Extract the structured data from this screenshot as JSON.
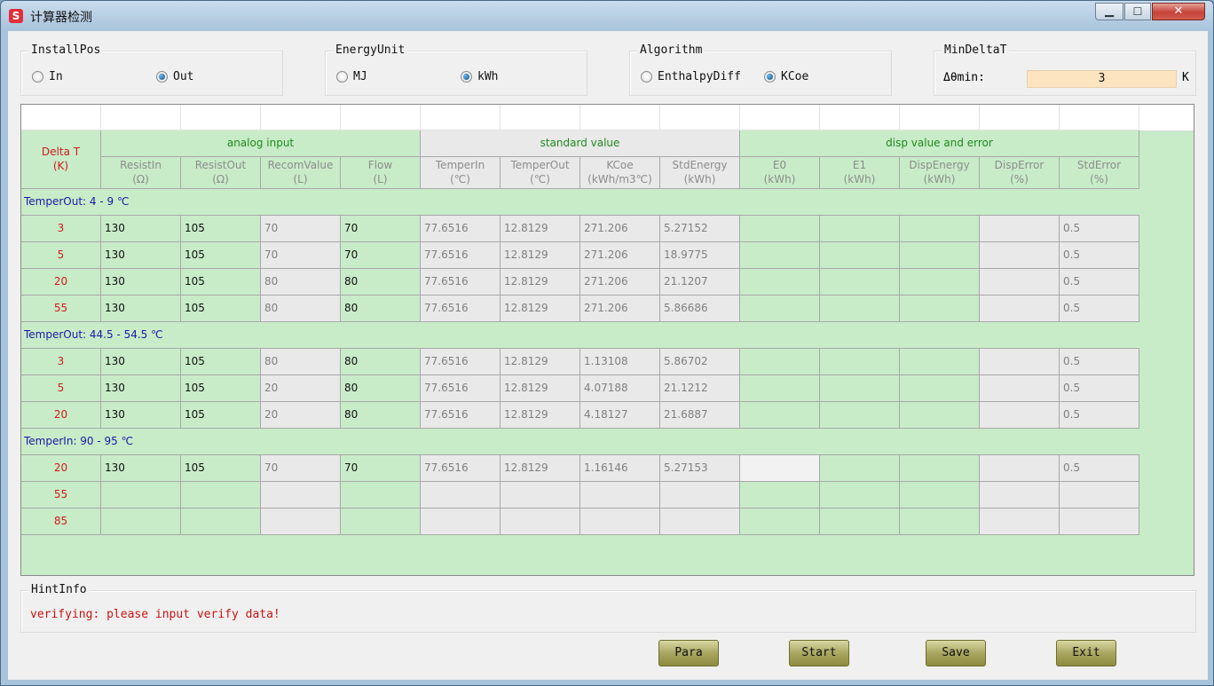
{
  "window": {
    "title": "计算器检测",
    "app_icon": "S",
    "minimize_glyph": "▁",
    "maximize_glyph": "☐",
    "close_glyph": "✕"
  },
  "install_pos": {
    "label": "InstallPos",
    "options": [
      "In",
      "Out"
    ],
    "selected": "Out"
  },
  "energy_unit": {
    "label": "EnergyUnit",
    "options": [
      "MJ",
      "kWh"
    ],
    "selected": "kWh"
  },
  "algorithm": {
    "label": "Algorithm",
    "options": [
      "EnthalpyDiff",
      "KCoe"
    ],
    "selected": "KCoe"
  },
  "min_delta": {
    "label": "MinDeltaT",
    "field_label": "Δθmin:",
    "value": "3",
    "unit": "K"
  },
  "grid": {
    "delta_header": [
      "Delta T",
      "(K)"
    ],
    "groups": [
      "analog input",
      "standard value",
      "disp value and error"
    ],
    "columns": [
      {
        "name": "ResistIn",
        "unit": "(Ω)"
      },
      {
        "name": "ResistOut",
        "unit": "(Ω)"
      },
      {
        "name": "RecomValue",
        "unit": "(L)"
      },
      {
        "name": "Flow",
        "unit": "(L)"
      },
      {
        "name": "TemperIn",
        "unit": "(℃)"
      },
      {
        "name": "TemperOut",
        "unit": "(℃)"
      },
      {
        "name": "KCoe",
        "unit": "(kWh/m3℃)"
      },
      {
        "name": "StdEnergy",
        "unit": "(kWh)"
      },
      {
        "name": "E0",
        "unit": "(kWh)"
      },
      {
        "name": "E1",
        "unit": "(kWh)"
      },
      {
        "name": "DispEnergy",
        "unit": "(kWh)"
      },
      {
        "name": "DispError",
        "unit": "(%)"
      },
      {
        "name": "StdError",
        "unit": "(%)"
      }
    ],
    "sections": [
      {
        "title": "TemperOut: 4 - 9 ℃",
        "rows": [
          {
            "dT": "3",
            "cells": [
              "130",
              "105",
              "70",
              "70",
              "77.6516",
              "12.8129",
              "271.206",
              "5.27152",
              "",
              "",
              "",
              "",
              "0.5"
            ]
          },
          {
            "dT": "5",
            "cells": [
              "130",
              "105",
              "70",
              "70",
              "77.6516",
              "12.8129",
              "271.206",
              "18.9775",
              "",
              "",
              "",
              "",
              "0.5"
            ]
          },
          {
            "dT": "20",
            "cells": [
              "130",
              "105",
              "80",
              "80",
              "77.6516",
              "12.8129",
              "271.206",
              "21.1207",
              "",
              "",
              "",
              "",
              "0.5"
            ]
          },
          {
            "dT": "55",
            "cells": [
              "130",
              "105",
              "80",
              "80",
              "77.6516",
              "12.8129",
              "271.206",
              "5.86686",
              "",
              "",
              "",
              "",
              "0.5"
            ]
          }
        ]
      },
      {
        "title": "TemperOut: 44.5 - 54.5 ℃",
        "rows": [
          {
            "dT": "3",
            "cells": [
              "130",
              "105",
              "80",
              "80",
              "77.6516",
              "12.8129",
              "1.13108",
              "5.86702",
              "",
              "",
              "",
              "",
              "0.5"
            ]
          },
          {
            "dT": "5",
            "cells": [
              "130",
              "105",
              "20",
              "80",
              "77.6516",
              "12.8129",
              "4.07188",
              "21.1212",
              "",
              "",
              "",
              "",
              "0.5"
            ]
          },
          {
            "dT": "20",
            "cells": [
              "130",
              "105",
              "20",
              "80",
              "77.6516",
              "12.8129",
              "4.18127",
              "21.6887",
              "",
              "",
              "",
              "",
              "0.5"
            ]
          }
        ]
      },
      {
        "title": "TemperIn: 90 - 95 ℃",
        "rows": [
          {
            "dT": "20",
            "cells": [
              "130",
              "105",
              "70",
              "70",
              "77.6516",
              "12.8129",
              "1.16146",
              "5.27153",
              "",
              "",
              "",
              "",
              "0.5"
            ]
          },
          {
            "dT": "55",
            "cells": [
              "",
              "",
              "",
              "",
              "",
              "",
              "",
              "",
              "",
              "",
              "",
              "",
              ""
            ]
          },
          {
            "dT": "85",
            "cells": [
              "",
              "",
              "",
              "",
              "",
              "",
              "",
              "",
              "",
              "",
              "",
              "",
              ""
            ]
          }
        ]
      }
    ]
  },
  "hint": {
    "label": "HintInfo",
    "text": "verifying: please input verify data!"
  },
  "buttons": {
    "para": "Para",
    "start": "Start",
    "save": "Save",
    "exit": "Exit"
  },
  "colors": {
    "grid_green": "#c8ecc8",
    "grid_gray": "#e9e9e9",
    "group_text": "#1e8a1e",
    "delta_red": "#d21a1a",
    "section_blue": "#1a1aa8",
    "hint_red": "#c81414"
  }
}
